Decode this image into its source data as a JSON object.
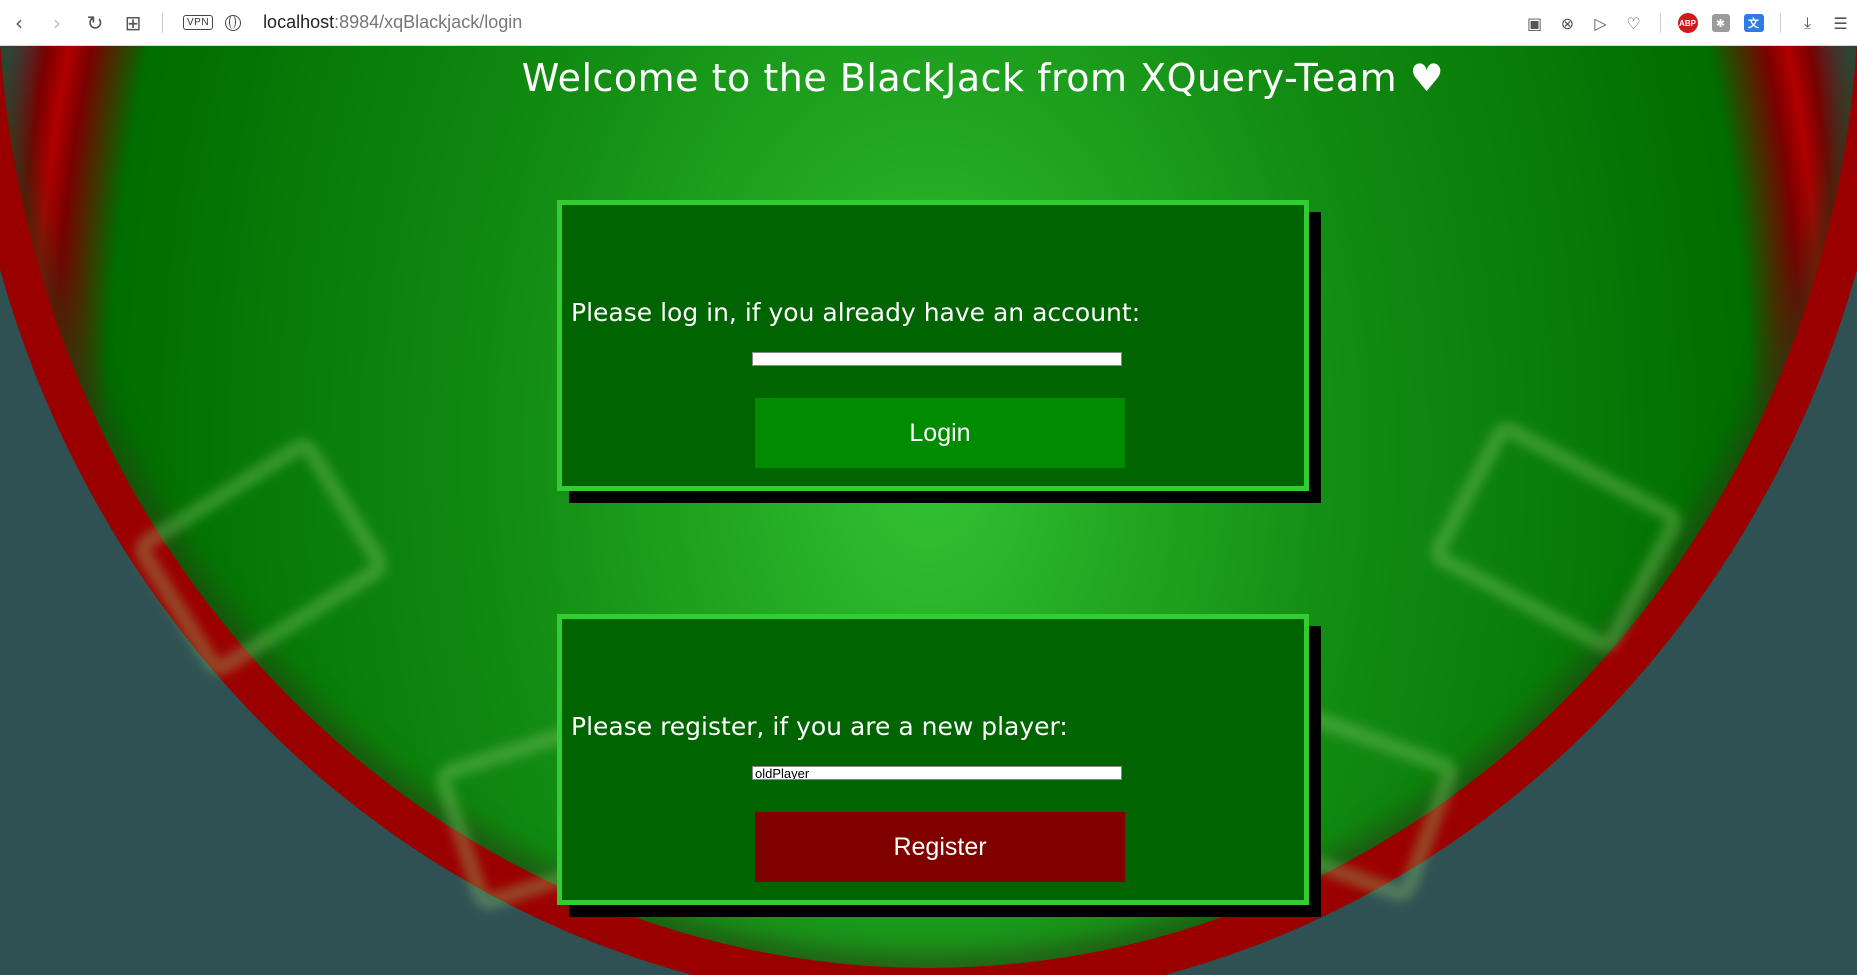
{
  "browser": {
    "url_host": "localhost",
    "url_path": ":8984/xqBlackjack/login",
    "vpn_label": "VPN",
    "extensions": {
      "abp_label": "ABP"
    }
  },
  "page": {
    "title": "Welcome to the BlackJack from XQuery-Team ♥"
  },
  "login": {
    "prompt": "Please log in, if you already have an account:",
    "input_value": "",
    "button_label": "Login",
    "button_color": "#008b00"
  },
  "register": {
    "prompt": "Please register, if you are a new player:",
    "input_value": "oldPlayer",
    "button_label": "Register",
    "button_color": "#800000"
  },
  "colors": {
    "felt": "#006400",
    "panel_border": "#32cd32",
    "table_rail": "#b20000"
  }
}
